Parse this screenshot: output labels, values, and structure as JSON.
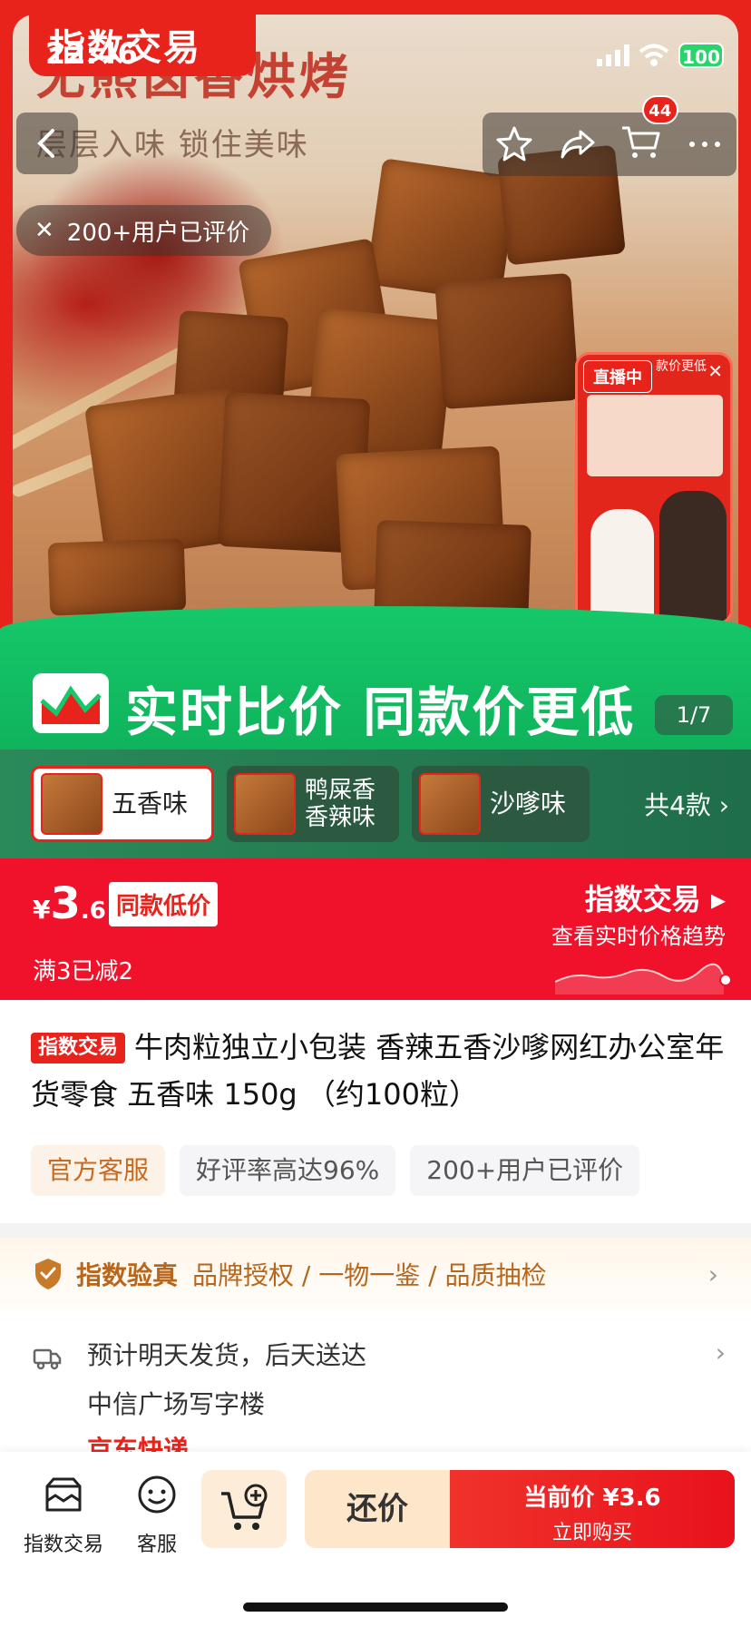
{
  "status": {
    "time": "22:46",
    "battery": "100"
  },
  "hero": {
    "brand": "指数交易",
    "headline": "无熊卤香烘烤",
    "subheadline": "层层入味 锁住美味",
    "review_pill": "200+用户已评价",
    "cart_count": "44",
    "page_indicator": "1/7"
  },
  "live": {
    "tag": "直播中",
    "header": "款价更低"
  },
  "banner": {
    "text": "实时比价 同款价更低"
  },
  "variants": {
    "items": [
      {
        "label": "五香味",
        "selected": true
      },
      {
        "label": "鸭屎香\n香辣味",
        "selected": false
      },
      {
        "label": "沙嗲味",
        "selected": false
      }
    ],
    "more": "共4款"
  },
  "price": {
    "currency": "¥",
    "integer": "3",
    "decimal": ".6",
    "tag": "同款低价",
    "discount": "满3已减2",
    "trend_title": "指数交易",
    "trend_sub": "查看实时价格趋势"
  },
  "product": {
    "tag": "指数交易",
    "title": "牛肉粒独立小包装 香辣五香沙嗲网红办公室年货零食 五香味 150g （约100粒）",
    "chips": [
      "官方客服",
      "好评率高达96%",
      "200+用户已评价"
    ]
  },
  "verify": {
    "title": "指数验真",
    "items": "品牌授权 / 一物一鉴 / 品质抽检"
  },
  "shipping": {
    "line1": "预计明天发货，后天送达",
    "line2": "中信广场写字楼",
    "carrier": "京东快递"
  },
  "bottom": {
    "nav1": "指数交易",
    "nav2": "客服",
    "haggle": "还价",
    "buy_line1": "当前价 ¥3.6",
    "buy_line2": "立即购买"
  },
  "colors": {
    "accent_red": "#e8231c",
    "banner_green": "#16c86a",
    "verify_gold": "#b7661b"
  }
}
